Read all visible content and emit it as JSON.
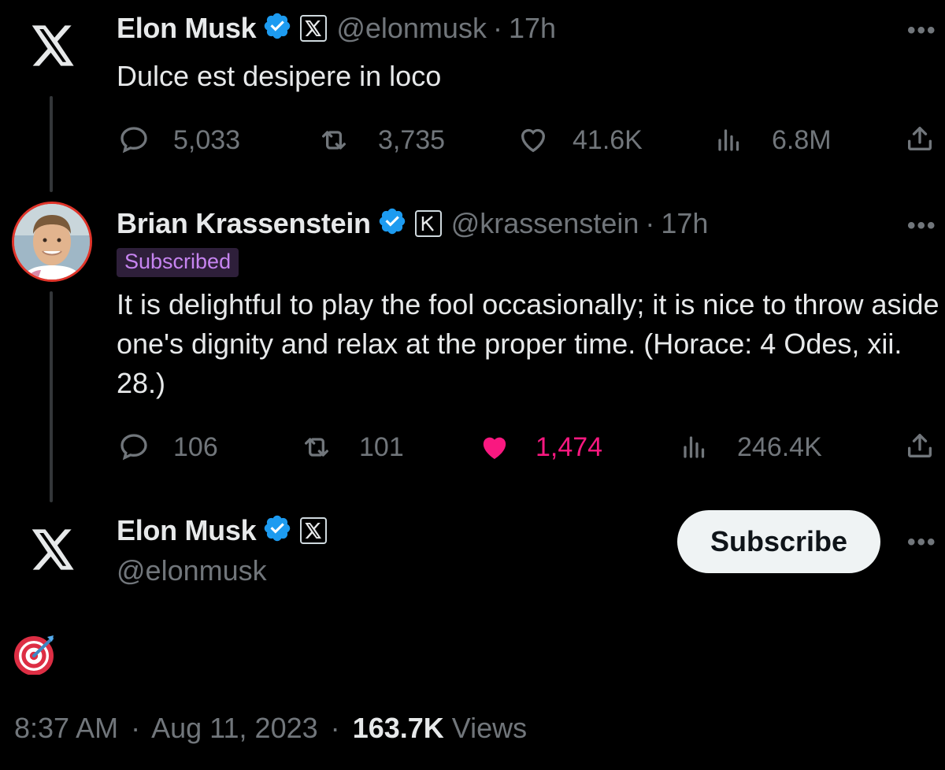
{
  "tweet1": {
    "name": "Elon Musk",
    "handle": "@elonmusk",
    "time": "17h",
    "text": "Dulce est desipere in loco",
    "replies": "5,033",
    "reposts": "3,735",
    "likes": "41.6K",
    "views": "6.8M"
  },
  "tweet2": {
    "name": "Brian Krassenstein",
    "handle": "@krassenstein",
    "time": "17h",
    "badge": "Subscribed",
    "text": "It is delightful to play the fool occasionally; it is nice to throw aside one's dignity and relax at the proper time. (Horace: 4 Odes, xii. 28.)",
    "replies": "106",
    "reposts": "101",
    "likes": "1,474",
    "views": "246.4K",
    "liked": true
  },
  "main_tweet": {
    "name": "Elon Musk",
    "handle": "@elonmusk",
    "subscribe_label": "Subscribe",
    "text_emoji": "🎯",
    "time": "8:37 AM",
    "date": "Aug 11, 2023",
    "views_count": "163.7K",
    "views_label": "Views"
  },
  "separator": "·",
  "more_label": "•••",
  "colors": {
    "background": "#000000",
    "text": "#e7e9ea",
    "secondary": "#71767b",
    "verified": "#1d9bf0",
    "like_active": "#f91880",
    "subscribed_bg": "#2e1f3a",
    "subscribed_text": "#c684f0"
  }
}
